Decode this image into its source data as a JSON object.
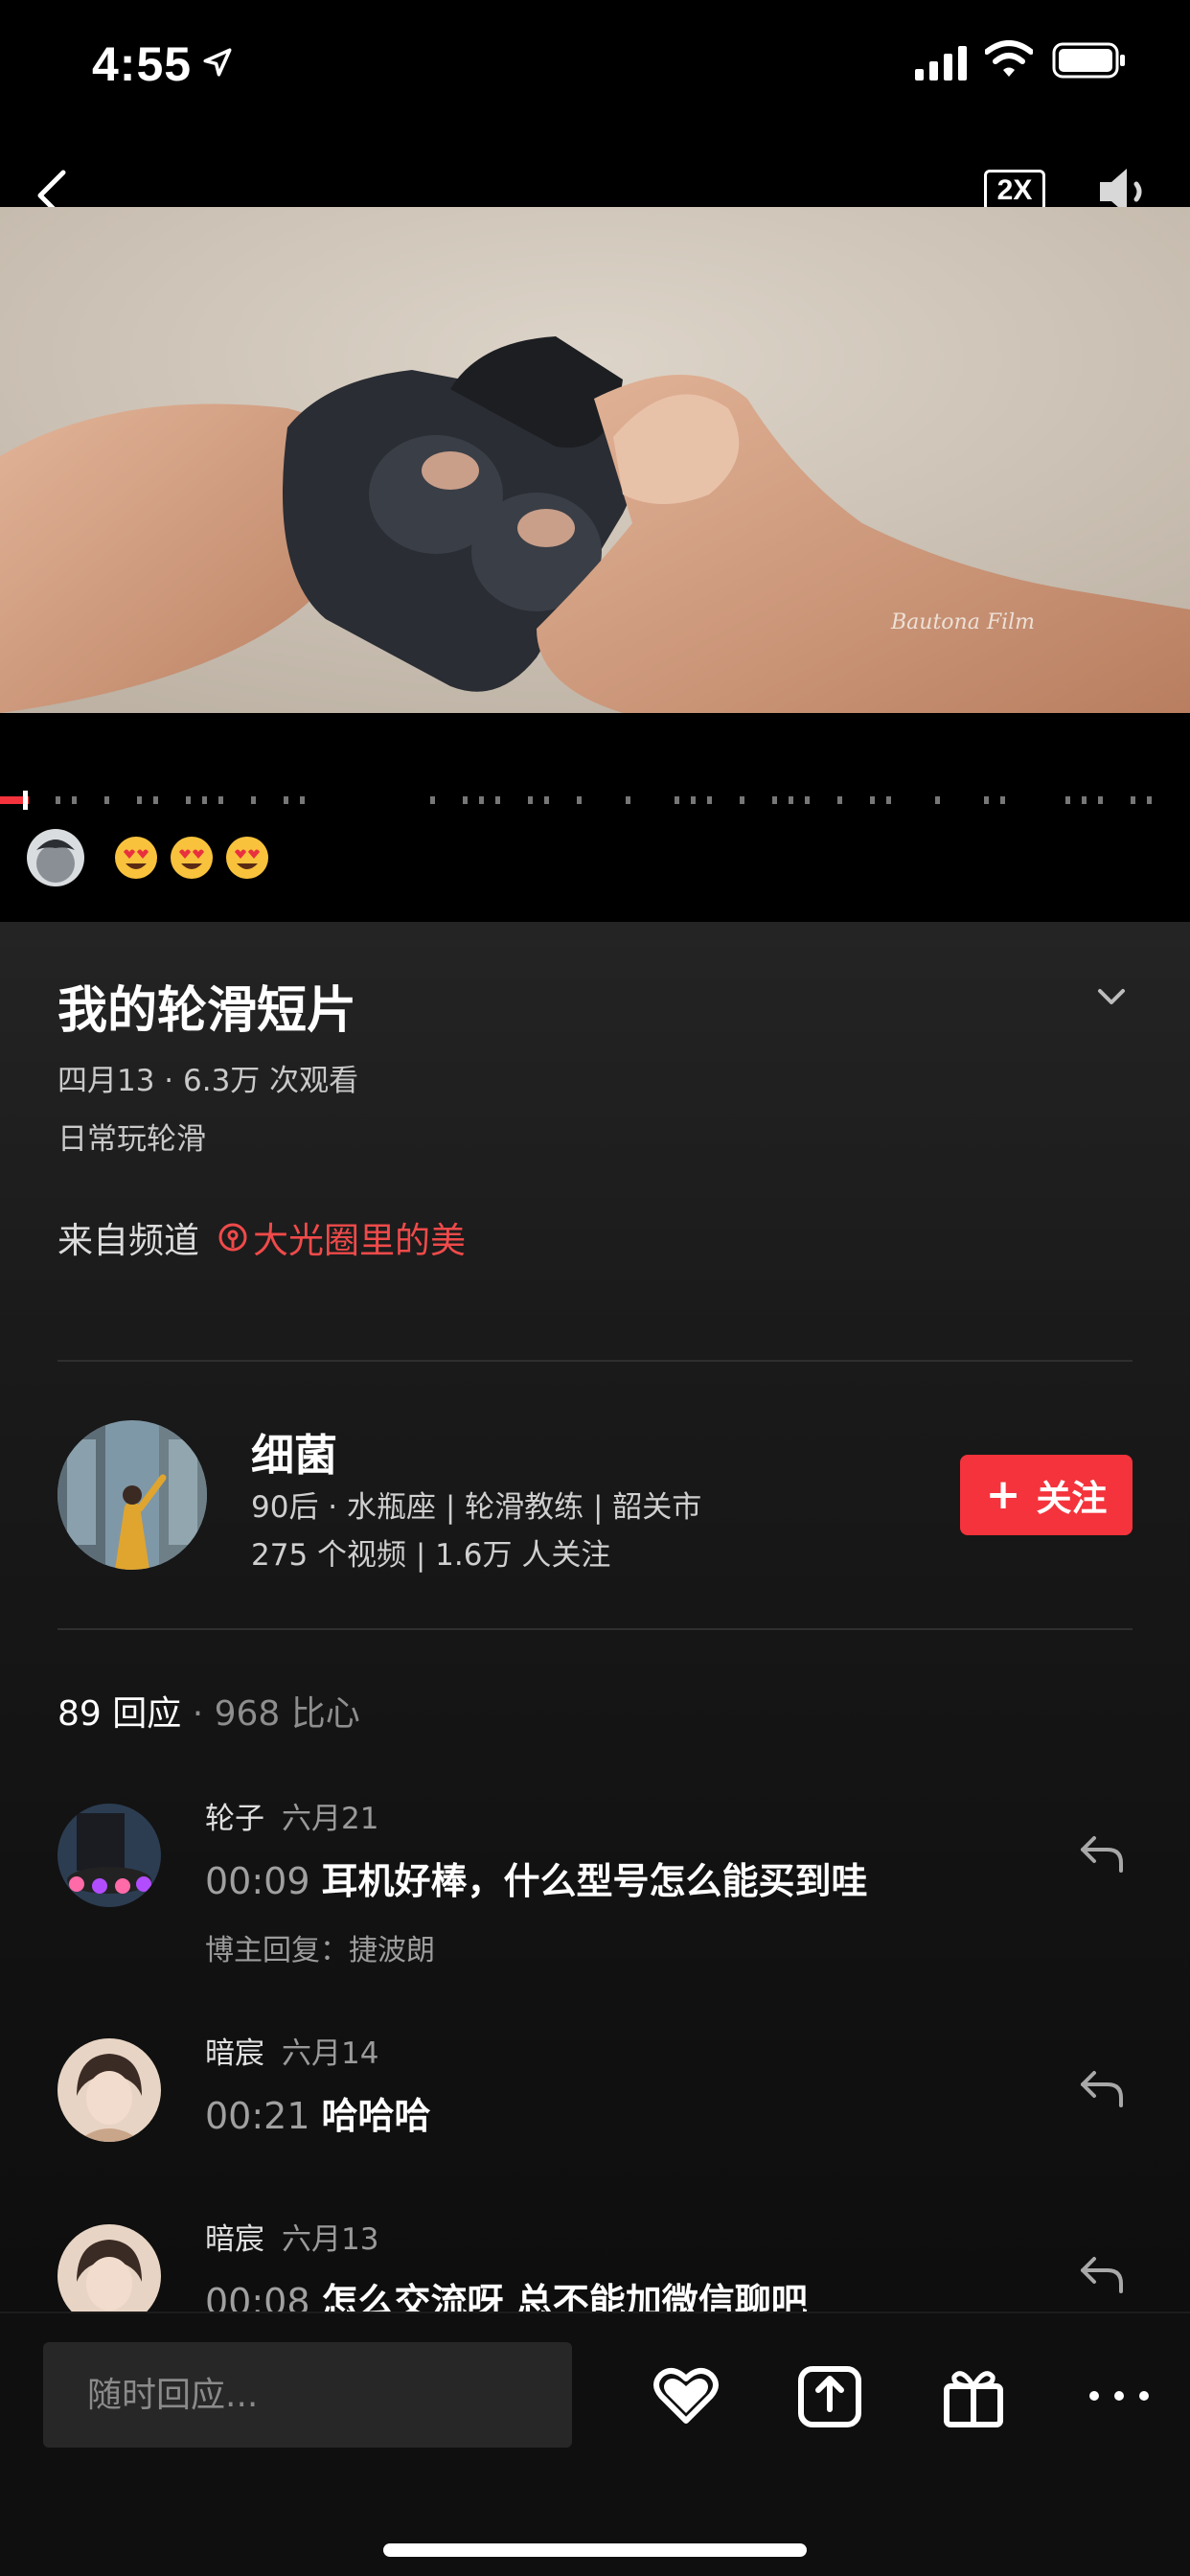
{
  "status_bar": {
    "time": "4:55"
  },
  "video": {
    "speed_label": "2X",
    "danmaku_emojis": [
      "smiling-face-with-heart-eyes",
      "smiling-face-with-heart-eyes",
      "smiling-face-with-heart-eyes"
    ]
  },
  "details": {
    "title": "我的轮滑短片",
    "meta": "四月13 · 6.3万 次观看",
    "description": "日常玩轮滑",
    "channel_prefix": "来自频道",
    "channel_name": "大光圈里的美"
  },
  "author": {
    "name": "细菌",
    "tags": "90后 · 水瓶座 | 轮滑教练 | 韶关市",
    "stats": "275 个视频 | 1.6万 人关注",
    "follow_label": "关注"
  },
  "comments_summary": {
    "count": "89 回应",
    "hearts": "· 968 比心"
  },
  "comments": [
    {
      "user": "轮子",
      "date": "六月21",
      "time": "00:09",
      "text": "耳机好棒，什么型号怎么能买到哇",
      "reply": "博主回复：捷波朗"
    },
    {
      "user": "暗宸",
      "date": "六月14",
      "time": "00:21",
      "text": "哈哈哈"
    },
    {
      "user": "暗宸",
      "date": "六月13",
      "time": "00:08",
      "text": "怎么交流呀 总不能加微信聊吧"
    }
  ],
  "bottom_bar": {
    "input_placeholder": "随时回应..."
  },
  "colors": {
    "accent": "#f4333c",
    "channel": "#f04a4a",
    "background": "#000000"
  }
}
